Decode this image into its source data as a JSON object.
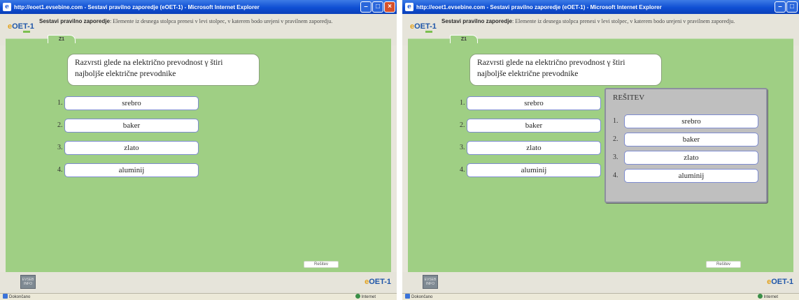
{
  "windows": [
    {
      "title": "http://eoet1.evsebine.com - Sestavi pravilno zaporedje (eOET-1) - Microsoft Internet Explorer",
      "logo": "OET-1",
      "instruction_title": "Sestavi pravilno zaporedje",
      "instruction_text": ": Elemente iz desnega stolpca prenesi v levi stolpec, v katerem bodo urejeni v pravilnem zaporedju.",
      "tab_label": "Z1",
      "question": "Razvrsti glede na električno prevodnost γ štiri najboljše električne prevodnike",
      "order_items": [
        {
          "num": "1.",
          "label": "srebro"
        },
        {
          "num": "2.",
          "label": "baker"
        },
        {
          "num": "3.",
          "label": "zlato"
        },
        {
          "num": "4.",
          "label": "aluminij"
        }
      ],
      "check_button": "Rešitev",
      "footer_badge": "EVSEB INFO",
      "footer_logo": "OET-1",
      "status_left": "Dokončano",
      "status_right": "Internet"
    },
    {
      "title": "http://eoet1.evsebine.com - Sestavi pravilno zaporedje (eOET-1) - Microsoft Internet Explorer",
      "logo": "OET-1",
      "instruction_title": "Sestavi pravilno zaporedje",
      "instruction_text": ": Elemente iz desnega stolpca prenesi v levi stolpec, v katerem bodo urejeni v pravilnem zaporedju.",
      "tab_label": "Z1",
      "question": "Razvrsti glede na električno prevodnost γ štiri najboljše električne prevodnike",
      "order_items": [
        {
          "num": "1.",
          "label": "srebro"
        },
        {
          "num": "2.",
          "label": "baker"
        },
        {
          "num": "3.",
          "label": "zlato"
        },
        {
          "num": "4.",
          "label": "aluminij"
        }
      ],
      "solution_title": "REŠITEV",
      "solution_items": [
        {
          "num": "1.",
          "label": "srebro"
        },
        {
          "num": "2.",
          "label": "baker"
        },
        {
          "num": "3.",
          "label": "zlato"
        },
        {
          "num": "4.",
          "label": "aluminij"
        }
      ],
      "check_button": "Rešitev",
      "footer_badge": "EVSEB INFO",
      "footer_logo": "OET-1",
      "status_left": "Dokončano",
      "status_right": "Internet"
    }
  ],
  "colors": {
    "stage_green": "#9fcf84",
    "titlebar_blue": "#0f4fd3",
    "logo_blue": "#1e55a8",
    "solution_gray": "#bfbfbf"
  }
}
